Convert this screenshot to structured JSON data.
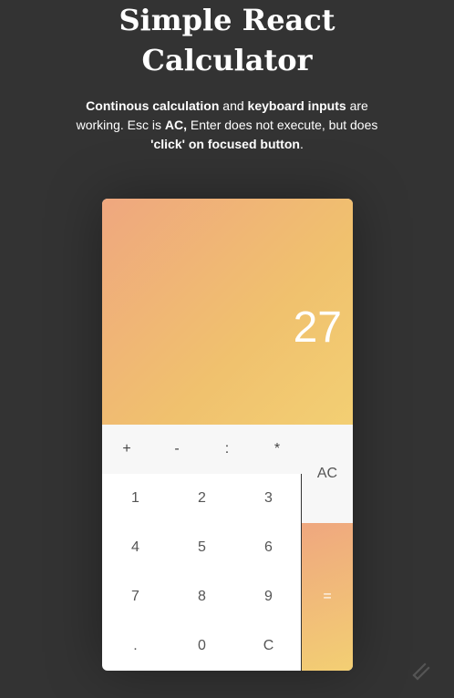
{
  "title": {
    "line1": "Simple React",
    "line2": "Calculator"
  },
  "description": {
    "part1": "Continous calculation",
    "part2": " and ",
    "part3": "keyboard inputs",
    "part4": " are working. Esc is ",
    "part5": "AC,",
    "part6": " Enter does not execute, but does ",
    "part7": "'click' on focused button",
    "part8": "."
  },
  "calculator": {
    "display": "27",
    "operators": [
      "+",
      "-",
      ":",
      "*"
    ],
    "clear_all": "AC",
    "equals": "=",
    "keys": [
      [
        "1",
        "2",
        "3"
      ],
      [
        "4",
        "5",
        "6"
      ],
      [
        "7",
        "8",
        "9"
      ],
      [
        ".",
        "0",
        "C"
      ]
    ]
  },
  "colors": {
    "background": "#333333",
    "gradient_start": "#efa77f",
    "gradient_end": "#f3cf73"
  },
  "icons": {
    "corner_logo": "codepen-icon"
  }
}
